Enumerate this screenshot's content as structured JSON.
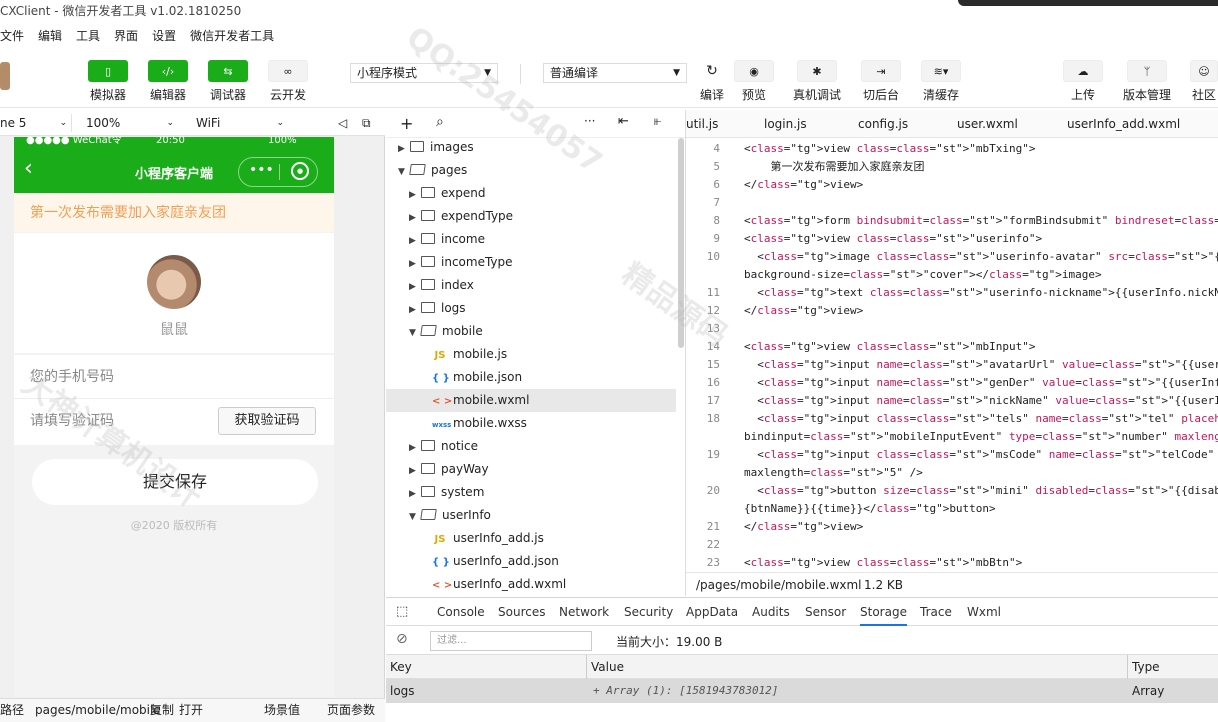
{
  "title": "CXClient - 微信开发者工具 v1.02.1810250",
  "menu": [
    "文件",
    "编辑",
    "工具",
    "界面",
    "设置",
    "微信开发者工具"
  ],
  "toolbar": {
    "simulator": "模拟器",
    "editor": "编辑器",
    "debugger": "调试器",
    "cloud": "云开发",
    "mode_select": "小程序模式",
    "compile_select": "普通编译",
    "compile": "编译",
    "preview": "预览",
    "remote_debug": "真机调试",
    "background": "切后台",
    "clear_cache": "清缓存",
    "upload": "上传",
    "version": "版本管理",
    "community": "社区"
  },
  "device_bar": {
    "device": "ne 5",
    "zoom": "100%",
    "network": "WiFi"
  },
  "phone": {
    "status_left": "●●●●● WeChat令",
    "status_time": "20:50",
    "status_right": "100%",
    "nav_title": "小程序客户端",
    "notice": "第一次发布需要加入家庭亲友团",
    "nickname": "鼠鼠",
    "phone_placeholder": "您的手机号码",
    "code_placeholder": "请填写验证码",
    "code_button": "获取验证码",
    "submit": "提交保存",
    "copyright": "@2020 版权所有"
  },
  "left_footer": {
    "label": "路径",
    "path": "pages/mobile/mobile",
    "copy": "复制",
    "open": "打开",
    "scene": "场景值",
    "params": "页面参数"
  },
  "tree": [
    {
      "name": "images",
      "type": "folder",
      "depth": 0,
      "open": false
    },
    {
      "name": "pages",
      "type": "folder",
      "depth": 0,
      "open": true
    },
    {
      "name": "expend",
      "type": "folder",
      "depth": 1,
      "open": false
    },
    {
      "name": "expendType",
      "type": "folder",
      "depth": 1,
      "open": false
    },
    {
      "name": "income",
      "type": "folder",
      "depth": 1,
      "open": false
    },
    {
      "name": "incomeType",
      "type": "folder",
      "depth": 1,
      "open": false
    },
    {
      "name": "index",
      "type": "folder",
      "depth": 1,
      "open": false
    },
    {
      "name": "logs",
      "type": "folder",
      "depth": 1,
      "open": false
    },
    {
      "name": "mobile",
      "type": "folder",
      "depth": 1,
      "open": true
    },
    {
      "name": "mobile.js",
      "type": "js",
      "depth": 2
    },
    {
      "name": "mobile.json",
      "type": "json",
      "depth": 2
    },
    {
      "name": "mobile.wxml",
      "type": "wxml",
      "depth": 2,
      "selected": true
    },
    {
      "name": "mobile.wxss",
      "type": "wxss",
      "depth": 2
    },
    {
      "name": "notice",
      "type": "folder",
      "depth": 1,
      "open": false
    },
    {
      "name": "payWay",
      "type": "folder",
      "depth": 1,
      "open": false
    },
    {
      "name": "system",
      "type": "folder",
      "depth": 1,
      "open": false
    },
    {
      "name": "userInfo",
      "type": "folder",
      "depth": 1,
      "open": true
    },
    {
      "name": "userInfo_add.js",
      "type": "js",
      "depth": 2
    },
    {
      "name": "userInfo_add.json",
      "type": "json",
      "depth": 2
    },
    {
      "name": "userInfo_add.wxml",
      "type": "wxml",
      "depth": 2
    }
  ],
  "editor_tabs": [
    "util.js",
    "login.js",
    "config.js",
    "user.wxml",
    "userInfo_add.wxml"
  ],
  "code": [
    {
      "n": "4",
      "t": "<view class=\"mbTxing\">"
    },
    {
      "n": "5",
      "t": "    第一次发布需要加入家庭亲友团"
    },
    {
      "n": "6",
      "t": "</view>"
    },
    {
      "n": "7",
      "t": ""
    },
    {
      "n": "8",
      "t": "<form bindsubmit=\"formBindsubmit\" bindreset=\"formReset\">"
    },
    {
      "n": "9",
      "t": "<view class=\"userinfo\">"
    },
    {
      "n": "10",
      "t": "  <image class=\"userinfo-avatar\" src=\"{{userInfo.avatarUrl}}\""
    },
    {
      "n": "",
      "t": "background-size=\"cover\"></image>"
    },
    {
      "n": "11",
      "t": "  <text class=\"userinfo-nickname\">{{userInfo.nickName}}</text>"
    },
    {
      "n": "12",
      "t": "</view>"
    },
    {
      "n": "13",
      "t": ""
    },
    {
      "n": "14",
      "t": "<view class=\"mbInput\">"
    },
    {
      "n": "15",
      "t": "  <input name=\"avatarUrl\" value=\"{{userInfo.avatarUrl}}\" style=\"display:"
    },
    {
      "n": "16",
      "t": "  <input name=\"genDer\" value=\"{{userInfo.gender}}\" style=\"display:none\""
    },
    {
      "n": "17",
      "t": "  <input name=\"nickName\" value=\"{{userInfo.nickName}}\" style=\"display:no"
    },
    {
      "n": "18",
      "t": "  <input class=\"tels\" name=\"tel\" placeholder=\"您的手机号码\""
    },
    {
      "n": "",
      "t": "bindinput=\"mobileInputEvent\" type=\"number\" maxlength=\"11\" />"
    },
    {
      "n": "19",
      "t": "  <input class=\"msCode\" name=\"telCode\" placeholder=\"请填写验证码\" type=\"n"
    },
    {
      "n": "",
      "t": "maxlength=\"5\" />"
    },
    {
      "n": "20",
      "t": "  <button size=\"mini\" disabled=\"{{disabled}}\" bindtap=\"reSendPhoneNum\" c"
    },
    {
      "n": "",
      "t": "{btnName}}{{time}}</button>"
    },
    {
      "n": "21",
      "t": "</view>"
    },
    {
      "n": "22",
      "t": ""
    },
    {
      "n": "23",
      "t": "<view class=\"mbBtn\">"
    }
  ],
  "editor_status": {
    "path": "/pages/mobile/mobile.wxml",
    "size": "1.2 KB"
  },
  "devtools": {
    "tabs": [
      "Console",
      "Sources",
      "Network",
      "Security",
      "AppData",
      "Audits",
      "Sensor",
      "Storage",
      "Trace",
      "Wxml"
    ],
    "active": "Storage",
    "filter_placeholder": "过滤...",
    "current_size": "当前大小：19.00 B",
    "columns": [
      "Key",
      "Value",
      "Type"
    ],
    "rows": [
      {
        "key": "logs",
        "value": "+ Array (1): [1581943783012]",
        "type": "Array"
      }
    ]
  },
  "watermark": [
    "QQ:25454057",
    "大神计算机设计",
    "精品源码"
  ],
  "colors": {
    "wechat_green": "#1aad19",
    "notice_text": "#f0a055",
    "notice_bg": "#fff6eb"
  }
}
